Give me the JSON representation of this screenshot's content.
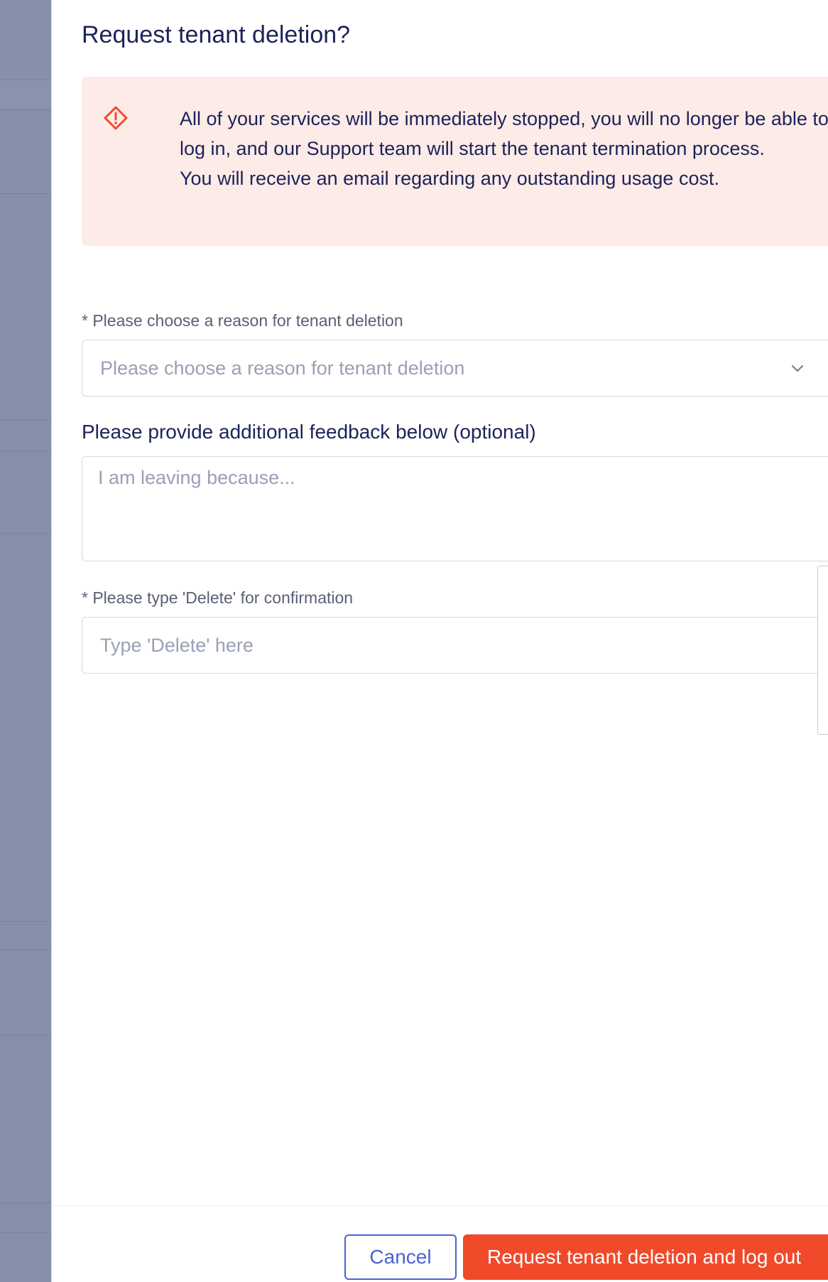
{
  "dialog": {
    "title": "Request tenant deletion?"
  },
  "alert": {
    "icon": "warning-diamond-icon",
    "lines": [
      "All of your services will be immediately stopped, you will no longer be able to log in, and our Support team will start the tenant termination process.",
      "You will receive an email regarding any outstanding usage cost."
    ],
    "background": "#fdebe8",
    "icon_color": "#f04a2a"
  },
  "reason": {
    "label": "* Please choose a reason for tenant deletion",
    "placeholder": "Please choose a reason for tenant deletion"
  },
  "feedback": {
    "label": "Please provide additional feedback below (optional)",
    "placeholder": "I am leaving because..."
  },
  "confirmation": {
    "label": "* Please type 'Delete' for confirmation",
    "placeholder": "Type 'Delete' here"
  },
  "footer": {
    "cancel_label": "Cancel",
    "delete_label": "Request tenant deletion and log out"
  },
  "colors": {
    "primary": "#4a63d4",
    "danger": "#f04a2a",
    "text": "#1c2359",
    "backdrop": "#8790aa"
  }
}
